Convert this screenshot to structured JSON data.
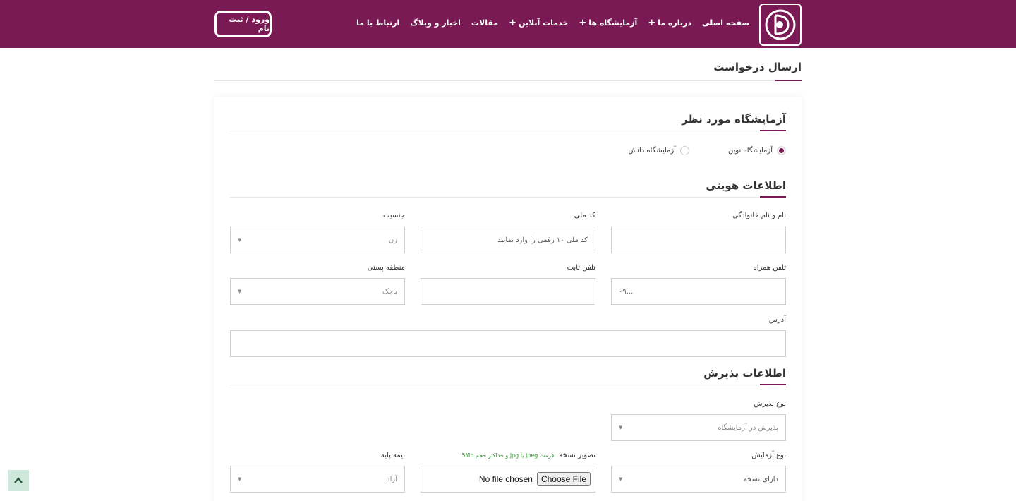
{
  "header": {
    "login_label": "ورود / ثبت نام",
    "nav": [
      {
        "label": "صفحه اصلی",
        "has_plus": false
      },
      {
        "label": "درباره ما",
        "has_plus": true
      },
      {
        "label": "آزمایشگاه ها",
        "has_plus": true
      },
      {
        "label": "خدمات آنلاین",
        "has_plus": true
      },
      {
        "label": "مقالات",
        "has_plus": false
      },
      {
        "label": "اخبار و وبلاگ",
        "has_plus": false
      },
      {
        "label": "ارتباط با ما",
        "has_plus": false
      }
    ],
    "plus_symbol": "+",
    "logo_icon": "lab-logo-icon"
  },
  "page": {
    "title": "ارسال درخواست"
  },
  "lab_section": {
    "title": "آزمایشگاه مورد نظر",
    "options": [
      {
        "label": "آزمایشگاه نوین",
        "selected": true
      },
      {
        "label": "آزمایشگاه دانش",
        "selected": false
      }
    ]
  },
  "identity_section": {
    "title": "اطلاعات هویتی",
    "full_name": {
      "label": "نام و نام خانوادگی",
      "value": ""
    },
    "national_code": {
      "label": "کد ملی",
      "placeholder": "کد ملی ۱۰ رقمی را وارد نمایید"
    },
    "gender": {
      "label": "جنسیت",
      "value": "زن"
    },
    "mobile": {
      "label": "تلفن همراه",
      "placeholder": "۰۹..."
    },
    "phone": {
      "label": "تلفن ثابت",
      "value": ""
    },
    "postal_region": {
      "label": "منطقه پستی",
      "value": "باجک"
    },
    "address": {
      "label": "آدرس",
      "value": ""
    }
  },
  "admission_section": {
    "title": "اطلاعات پذیرش",
    "admission_type": {
      "label": "نوع پذیرش",
      "value": "پذیرش در آزمایشگاه"
    },
    "test_type": {
      "label": "نوع آزمایش",
      "value": "دارای نسخه"
    },
    "prescription": {
      "label": "تصویر نسخه",
      "hint": "فرمت jpeg یا jpg و حداکثر حجم 5Mb",
      "button": "Choose File",
      "status": "No file chosen"
    },
    "insurance": {
      "label": "بیمه پایه",
      "value": "آزاد"
    }
  },
  "colors": {
    "brand": "#7a1a55",
    "hint_green": "#2a8a2a"
  },
  "scroll_top_icon": "chevron-up-icon"
}
